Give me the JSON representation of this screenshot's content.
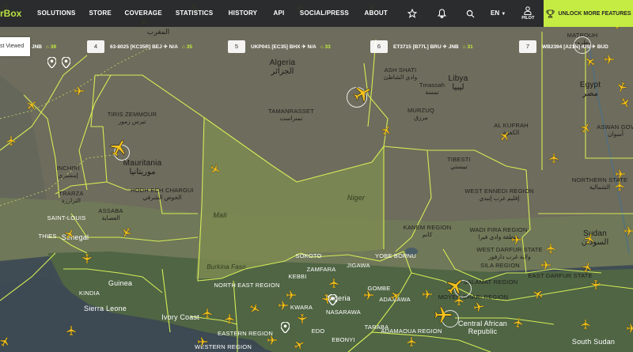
{
  "nav": {
    "logo_text": "rBox",
    "items": [
      "SOLUTIONS",
      "STORE",
      "COVERAGE",
      "STATISTICS",
      "HISTORY",
      "API",
      "SOCIAL/PRESS",
      "ABOUT"
    ],
    "language": "EN",
    "pilot_label": "PILOT",
    "unlock_label": "UNLOCK MORE FEATURES",
    "icons": [
      "star-icon",
      "bell-icon",
      "search-icon",
      "user-icon",
      "trophy-icon"
    ]
  },
  "most_viewed": {
    "label": "st Viewed",
    "items": [
      {
        "rank": "",
        "route": "JNB",
        "count": "39"
      },
      {
        "rank": "4",
        "route": "63-8025 [KC35R]  BEJ ✈ N/A",
        "count": "35"
      },
      {
        "rank": "5",
        "route": "UKP041 [EC35]  BHX ✈ N/A",
        "count": "33"
      },
      {
        "rank": "6",
        "route": "ET3715 [B77L]  BRU ✈ JNB",
        "count": "31"
      },
      {
        "rank": "7",
        "route": "WB2394 [A21N]  IUS ✈ BUD",
        "count": ""
      }
    ]
  },
  "map": {
    "countries": [
      {
        "name": "Algeria",
        "ar": "الجزائر"
      },
      {
        "name": "Libya",
        "ar": "ليبيا"
      },
      {
        "name": "Egypt",
        "ar": "مصر"
      },
      {
        "name": "Mauritania",
        "ar": "موريتانيا"
      },
      {
        "name": "Mali",
        "ar": ""
      },
      {
        "name": "Niger",
        "ar": ""
      },
      {
        "name": "Burkina Faso",
        "ar": ""
      },
      {
        "name": "Sudan",
        "ar": "السودان"
      },
      {
        "name": "Senegal",
        "ar": ""
      },
      {
        "name": "Guinea",
        "ar": ""
      },
      {
        "name": "Sierra Leone",
        "ar": ""
      },
      {
        "name": "Ivory Coast",
        "ar": ""
      },
      {
        "name": "Nigeria",
        "ar": ""
      },
      {
        "name": "Central African Republic",
        "ar": ""
      }
    ],
    "regions": [
      {
        "name": "MATROUH",
        "ar": "مطروح"
      },
      {
        "name": "ASH SHATI",
        "ar": "وادي الشاطئ"
      },
      {
        "name": "Tmassah",
        "ar": "تمسة"
      },
      {
        "name": "MURZUQ",
        "ar": "مرزق"
      },
      {
        "name": "TAMANRASSET",
        "ar": "تمنراست"
      },
      {
        "name": "TIRIS ZEMMOUR",
        "ar": "تيرس زمور"
      },
      {
        "name": "INCHIRI",
        "ar": "إينشيري"
      },
      {
        "name": "HODH ECH CHARGUI",
        "ar": "الحوض الشرقي"
      },
      {
        "name": "TRARZA",
        "ar": "الترارزة"
      },
      {
        "name": "ASSABA",
        "ar": "العصابة"
      },
      {
        "name": "SAINT-LOUIS",
        "ar": ""
      },
      {
        "name": "THIES",
        "ar": ""
      },
      {
        "name": "KINDIA",
        "ar": ""
      },
      {
        "name": "AL KUFRAH",
        "ar": "الكفرة"
      },
      {
        "name": "ASWAN GOV",
        "ar": "أسوان"
      },
      {
        "name": "NORTHERN STATE",
        "ar": "الشمالية"
      },
      {
        "name": "TIBESTI",
        "ar": "تيبستي"
      },
      {
        "name": "WEST ENNEDI REGION",
        "ar": "إقليم غرب إنيدي"
      },
      {
        "name": "KANEM REGION",
        "ar": "كانم"
      },
      {
        "name": "WADI FIRA REGION",
        "ar": "منطقة وادي فيرا"
      },
      {
        "name": "WEST DARFUR STATE",
        "ar": "ولاية غرب دارفور"
      },
      {
        "name": "SILA REGION",
        "ar": ""
      },
      {
        "name": "EAST DARFUR STATE",
        "ar": ""
      },
      {
        "name": "SALAMAT REGION",
        "ar": ""
      },
      {
        "name": "MOYEN-CHARI REGION",
        "ar": ""
      },
      {
        "name": "SOKOTO",
        "ar": ""
      },
      {
        "name": "JIGAWA",
        "ar": ""
      },
      {
        "name": "YOBE BORNU",
        "ar": ""
      },
      {
        "name": "ZAMFARA",
        "ar": ""
      },
      {
        "name": "KEBBI",
        "ar": ""
      },
      {
        "name": "GOMBE",
        "ar": ""
      },
      {
        "name": "ADAMAWA",
        "ar": ""
      },
      {
        "name": "KWARA",
        "ar": ""
      },
      {
        "name": "NASARAWA",
        "ar": ""
      },
      {
        "name": "EDO",
        "ar": ""
      },
      {
        "name": "EBONYI",
        "ar": ""
      },
      {
        "name": "TARABA",
        "ar": ""
      },
      {
        "name": "ADAMAOUA REGION",
        "ar": ""
      },
      {
        "name": "NORTH EAST REGION",
        "ar": ""
      },
      {
        "name": "EASTERN REGION",
        "ar": ""
      },
      {
        "name": "WESTERN REGION",
        "ar": ""
      },
      {
        "name": "South Sudan",
        "ar": ""
      },
      {
        "name": "المغرب",
        "ar": ""
      }
    ]
  },
  "colors": {
    "accent": "#c5ec42",
    "nav_bg": "#26282a",
    "border": "#d4ec56",
    "plane": "#f7c31b"
  }
}
